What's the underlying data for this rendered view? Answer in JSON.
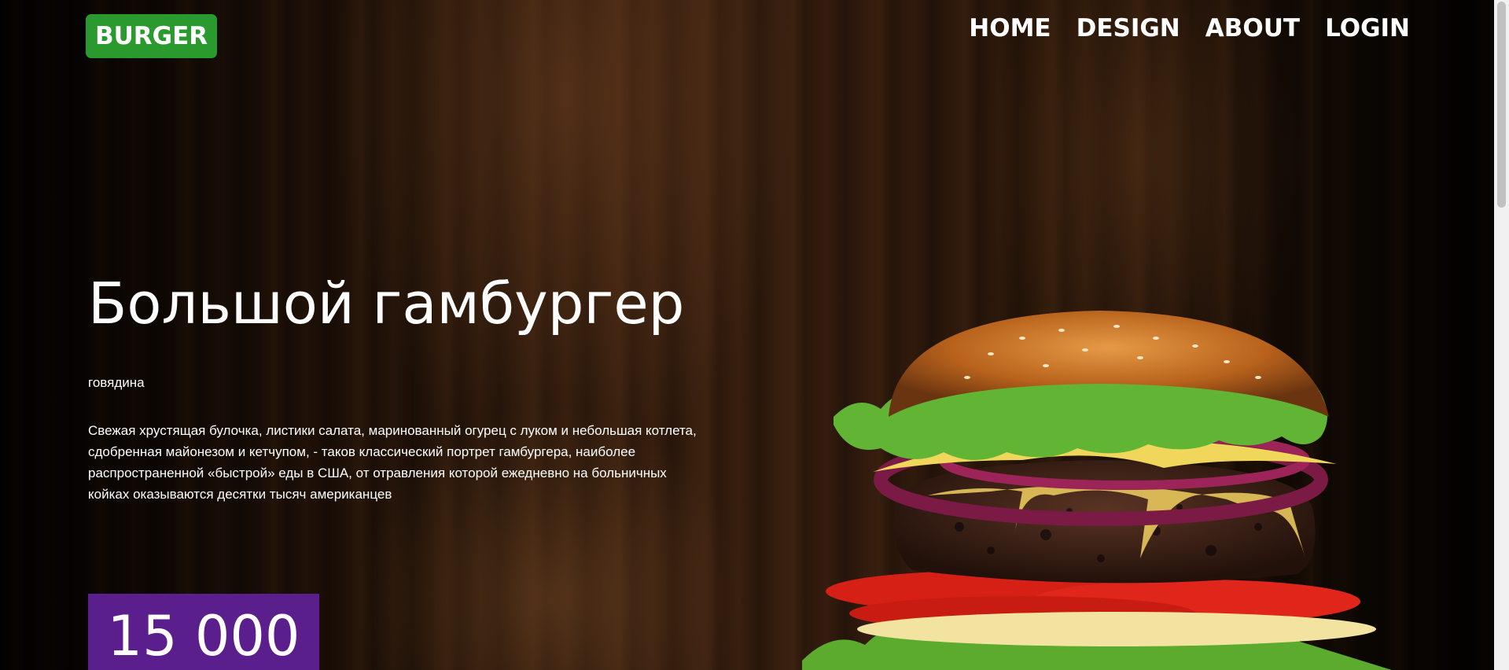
{
  "header": {
    "logo": "BURGER",
    "nav": [
      "HOME",
      "DESIGN",
      "ABOUT",
      "LOGIN"
    ]
  },
  "hero": {
    "title": "Большой гамбургер",
    "subtitle": "говядина",
    "description": "Свежая хрустящая булочка, листики салата, маринованный огурец с луком и небольшая котлета, сдобренная майонезом и кетчупом, - таков классический портрет гамбургера, наиболее распространенной «быстрой» еды в США, от отравления которой ежедневно на больничных койках оказываются десятки тысяч американцев",
    "price": "15 000"
  },
  "colors": {
    "logo_bg": "#2a9a2e",
    "price_bg": "#5a1f8c"
  },
  "icons": {
    "hero_image": "burger-image"
  }
}
